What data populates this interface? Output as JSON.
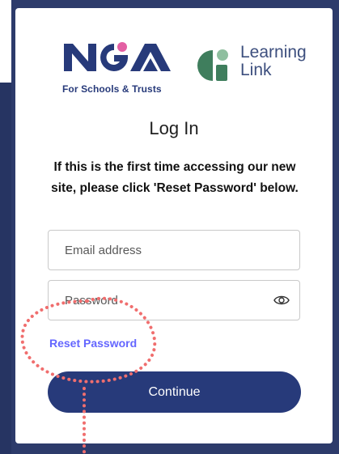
{
  "logos": {
    "nga_tagline": "For Schools & Trusts",
    "learning_link_line1": "Learning",
    "learning_link_line2": "Link"
  },
  "colors": {
    "brand_navy": "#273a7a",
    "accent_pink": "#e35fa3",
    "learning_link_green": "#3f7e5d",
    "link_purple": "#6466ff",
    "annotation_red": "#f06e6e"
  },
  "login": {
    "title": "Log In",
    "notice": "If this is the first time accessing our new site, please click 'Reset Password' below.",
    "email_placeholder": "Email address",
    "password_placeholder": "Password",
    "show_password_icon": "eye-icon",
    "reset_password_label": "Reset Password",
    "continue_label": "Continue"
  }
}
